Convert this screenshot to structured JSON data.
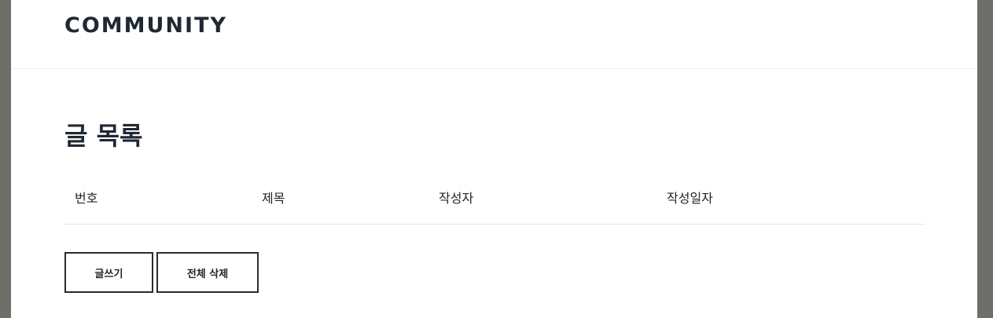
{
  "header": {
    "brand": "COMMUNITY"
  },
  "main": {
    "title": "글 목록",
    "table": {
      "columns": [
        "번호",
        "제목",
        "작성자",
        "작성일자"
      ],
      "rows": []
    },
    "buttons": {
      "write": "글쓰기",
      "delete_all": "전체 삭제"
    }
  }
}
